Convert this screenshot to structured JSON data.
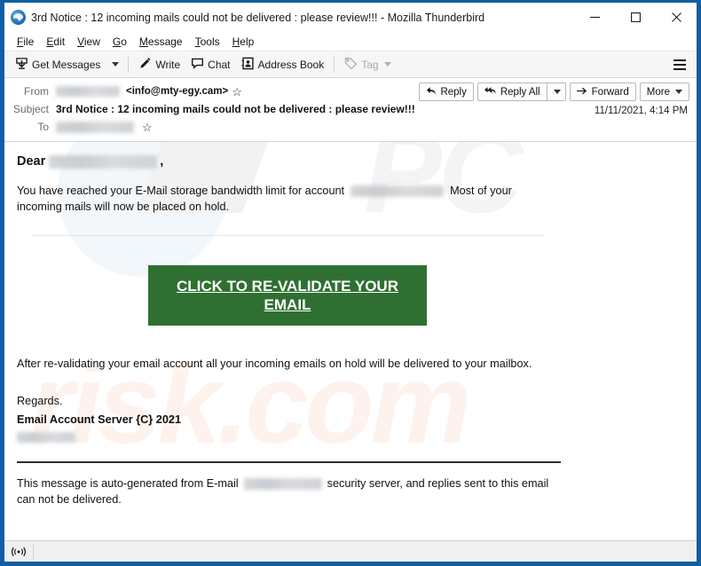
{
  "window": {
    "title": "3rd Notice : 12 incoming mails could not be delivered : please review!!! - Mozilla Thunderbird",
    "app_icon": "thunderbird-icon",
    "controls": {
      "minimize": "minimize-icon",
      "maximize": "maximize-icon",
      "close": "close-icon"
    }
  },
  "menubar": {
    "items": [
      {
        "label": "File",
        "accel": "F"
      },
      {
        "label": "Edit",
        "accel": "E"
      },
      {
        "label": "View",
        "accel": "V"
      },
      {
        "label": "Go",
        "accel": "G"
      },
      {
        "label": "Message",
        "accel": "M"
      },
      {
        "label": "Tools",
        "accel": "T"
      },
      {
        "label": "Help",
        "accel": "H"
      }
    ]
  },
  "toolbar": {
    "get_messages": "Get Messages",
    "write": "Write",
    "chat": "Chat",
    "address_book": "Address Book",
    "tag": "Tag",
    "app_menu": "app-menu-icon"
  },
  "message_header": {
    "from_label": "From",
    "from_name_redacted": "",
    "from_address": "<info@mty-egy.cam>",
    "subject_label": "Subject",
    "subject": "3rd Notice : 12 incoming mails could not be delivered : please review!!!",
    "to_label": "To",
    "to_redacted": "",
    "date": "11/11/2021, 4:14 PM",
    "star_icon": "star-icon",
    "actions": {
      "reply": "Reply",
      "reply_all": "Reply All",
      "reply_all_more": "chevron-down-icon",
      "forward": "Forward",
      "more": "More"
    }
  },
  "message_body": {
    "greeting_prefix": "Dear",
    "greeting_redacted": "",
    "greeting_suffix": ",",
    "para1_before": "You have reached your E-Mail storage bandwidth limit for account",
    "para1_redacted": "",
    "para1_after": "Most of your incoming mails will now be placed on hold.",
    "cta_label": "CLICK TO RE-VALIDATE YOUR EMAIL",
    "cta_color": "#2f7032",
    "para2": "After re-validating your email account all your incoming emails on hold will be delivered to your mailbox.",
    "regards": "Regards.",
    "signature": "Email Account Server {C} 2021",
    "signature_redacted": "",
    "footer_before": "This message is auto-generated from E-mail",
    "footer_redacted": "",
    "footer_after": "security server, and replies sent to this email can not be delivered.",
    "watermark_text": "pcrisk.com"
  },
  "statusbar": {
    "icon": "broadcast-icon",
    "text": ""
  }
}
